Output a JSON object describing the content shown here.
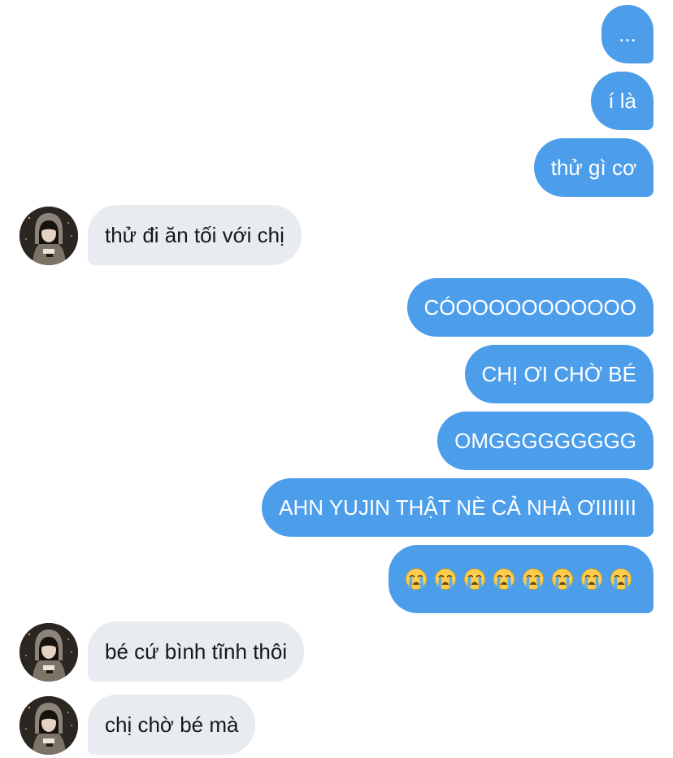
{
  "conversation": {
    "messages": [
      {
        "sender": "me",
        "text": "..."
      },
      {
        "sender": "me",
        "text": "í là"
      },
      {
        "sender": "me",
        "text": "thử gì cơ"
      },
      {
        "sender": "other",
        "text": "thử đi ăn tối với chị"
      },
      {
        "sender": "me",
        "text": "CÓOOOOOOOOOOO"
      },
      {
        "sender": "me",
        "text": "CHỊ ƠI CHỜ BÉ"
      },
      {
        "sender": "me",
        "text": "OMGGGGGGGGG"
      },
      {
        "sender": "me",
        "text": "AHN YUJIN THẬT NÈ CẢ NHÀ ƠIIIIIII"
      },
      {
        "sender": "me",
        "type": "emoji",
        "emoji": "loudly-crying-face",
        "count": 8
      },
      {
        "sender": "other",
        "text": "bé cứ bình tĩnh thôi"
      },
      {
        "sender": "other",
        "text": "chị chờ bé mà"
      }
    ],
    "avatar_icon": "user-avatar-photo"
  },
  "colors": {
    "outgoing_bubble": "#4c9eeb",
    "incoming_bubble": "#e8ebf0",
    "outgoing_text": "#ffffff",
    "incoming_text": "#14171a"
  }
}
